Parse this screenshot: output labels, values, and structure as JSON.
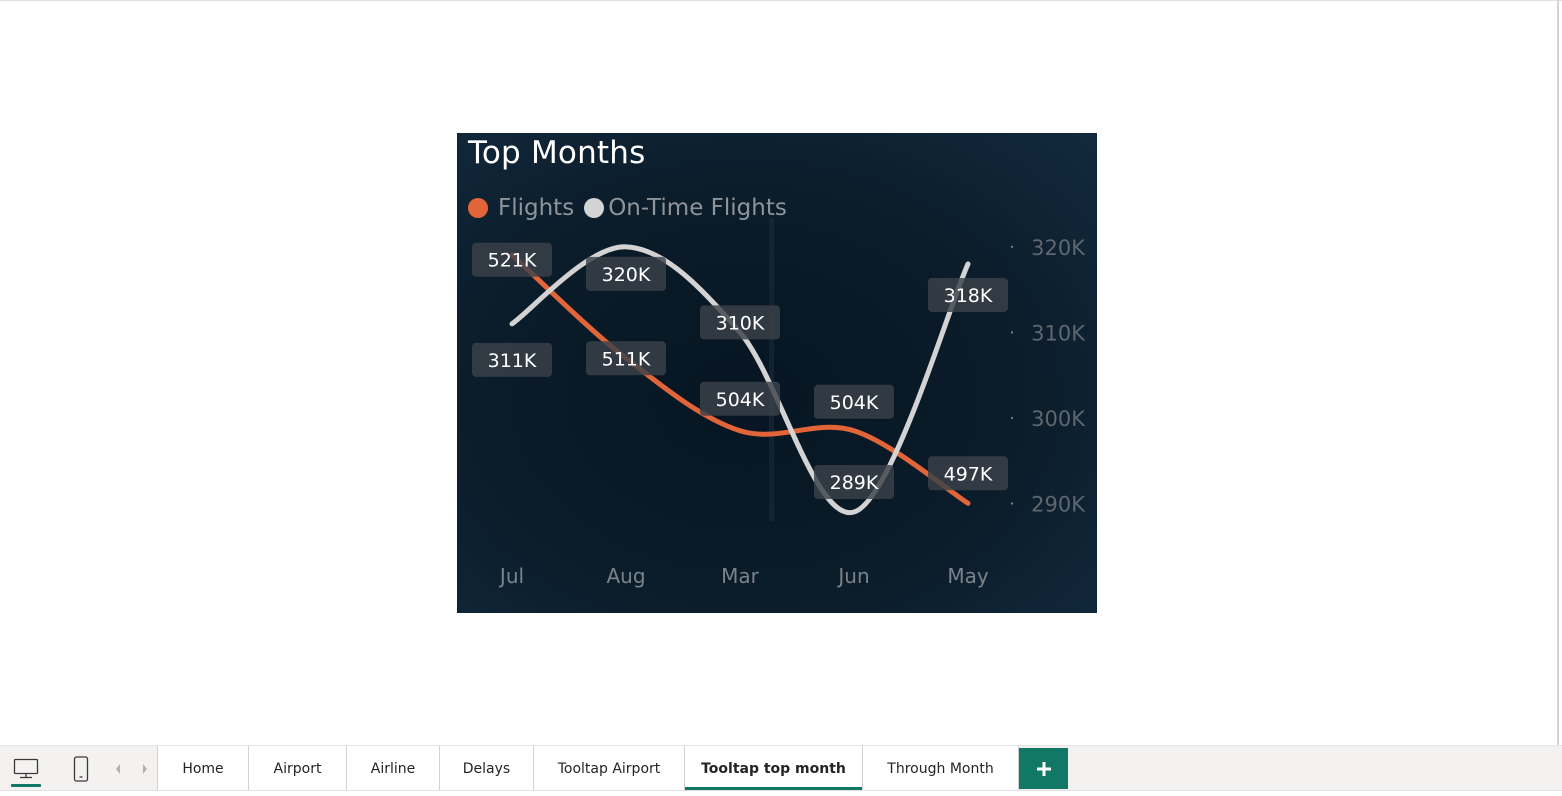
{
  "chart_data": {
    "type": "line",
    "title": "Top Months",
    "categories": [
      "Jul",
      "Aug",
      "Mar",
      "Jun",
      "May"
    ],
    "series": [
      {
        "name": "Flights",
        "values": [
          521,
          511,
          504,
          504,
          497
        ],
        "labels": [
          "521K",
          "511K",
          "504K",
          "504K",
          "497K"
        ],
        "color": "#e2653a",
        "axis": "hidden-left"
      },
      {
        "name": "On-Time Flights",
        "values": [
          311,
          320,
          310,
          289,
          318
        ],
        "labels": [
          "311K",
          "320K",
          "310K",
          "289K",
          "318K"
        ],
        "color": "#d3d3d3",
        "axis": "right"
      }
    ],
    "y_right": {
      "ticks": [
        "320K",
        "310K",
        "300K",
        "290K"
      ],
      "tick_values": [
        320,
        310,
        300,
        290
      ],
      "ylim": [
        287.6,
        321.5
      ]
    },
    "y_left_hidden": {
      "ylim": [
        495,
        523
      ]
    },
    "grid": false,
    "legend_position": "top-left",
    "smooth_lines": true,
    "background": "#0b1c2a"
  },
  "view_buttons": {
    "desktop": "desktop-view-icon",
    "mobile": "mobile-view-icon"
  },
  "nav": {
    "prev": "chevron-left-icon",
    "next": "chevron-right-icon"
  },
  "pages": [
    {
      "label": "Home",
      "active": false
    },
    {
      "label": "Airport",
      "active": false
    },
    {
      "label": "Airline",
      "active": false
    },
    {
      "label": "Delays",
      "active": false
    },
    {
      "label": "Tooltap Airport",
      "active": false
    },
    {
      "label": "Tooltap top month",
      "active": true
    },
    {
      "label": "Through Month",
      "active": false
    }
  ],
  "add_page": {
    "icon": "plus-icon",
    "color": "#117865"
  }
}
